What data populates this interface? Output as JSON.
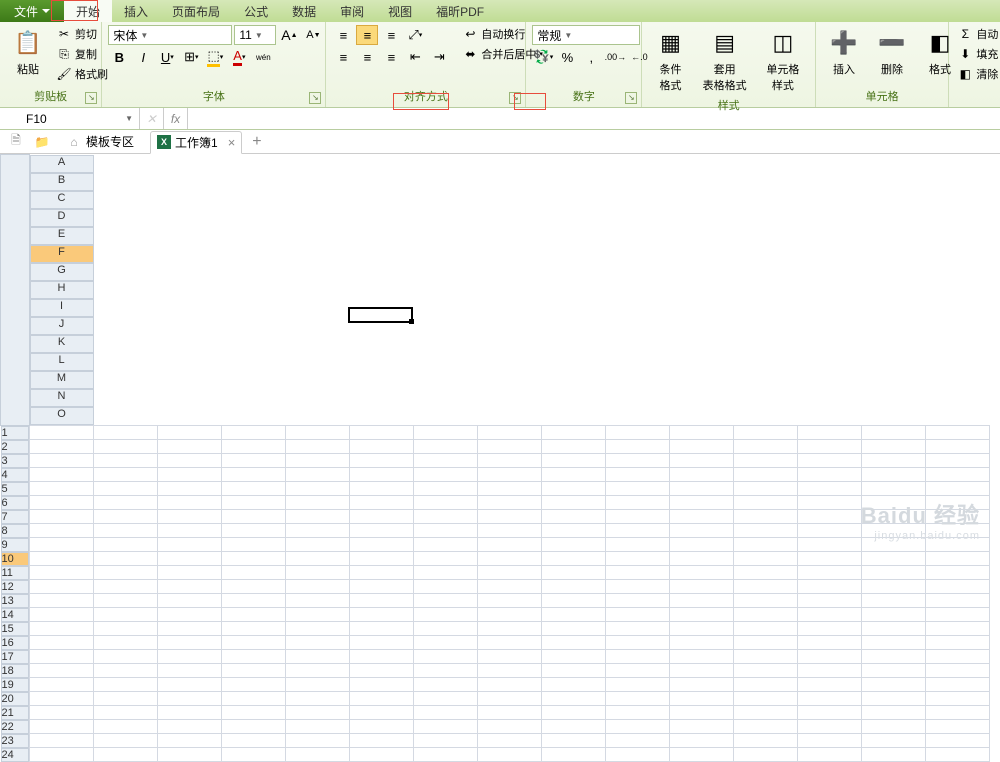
{
  "menu": {
    "file": "文件",
    "tabs": [
      "开始",
      "插入",
      "页面布局",
      "公式",
      "数据",
      "审阅",
      "视图",
      "福昕PDF"
    ],
    "active": 0
  },
  "ribbon": {
    "clipboard": {
      "label": "剪贴板",
      "paste": "粘贴",
      "cut": "剪切",
      "copy": "复制",
      "painter": "格式刷"
    },
    "font": {
      "label": "字体",
      "name": "宋体",
      "size": "11"
    },
    "align": {
      "label": "对齐方式",
      "wrap": "自动换行",
      "merge": "合并后居中"
    },
    "number": {
      "label": "数字",
      "format": "常规"
    },
    "styles": {
      "label": "样式",
      "cond": "条件格式",
      "table": "套用\n表格格式",
      "cell": "单元格样式"
    },
    "cells": {
      "label": "单元格",
      "insert": "插入",
      "delete": "删除",
      "format": "格式"
    },
    "editing": {
      "autosum": "自动",
      "fill": "填充",
      "clear": "清除"
    }
  },
  "namebox": "F10",
  "sheettabs": {
    "template": "模板专区",
    "book": "工作簿1"
  },
  "columns": [
    "A",
    "B",
    "C",
    "D",
    "E",
    "F",
    "G",
    "H",
    "I",
    "J",
    "K",
    "L",
    "M",
    "N",
    "O"
  ],
  "rows": 24,
  "selected": {
    "col": 5,
    "row": 9
  },
  "watermark": {
    "main": "Baidu 经验",
    "sub": "jingyan.baidu.com"
  }
}
